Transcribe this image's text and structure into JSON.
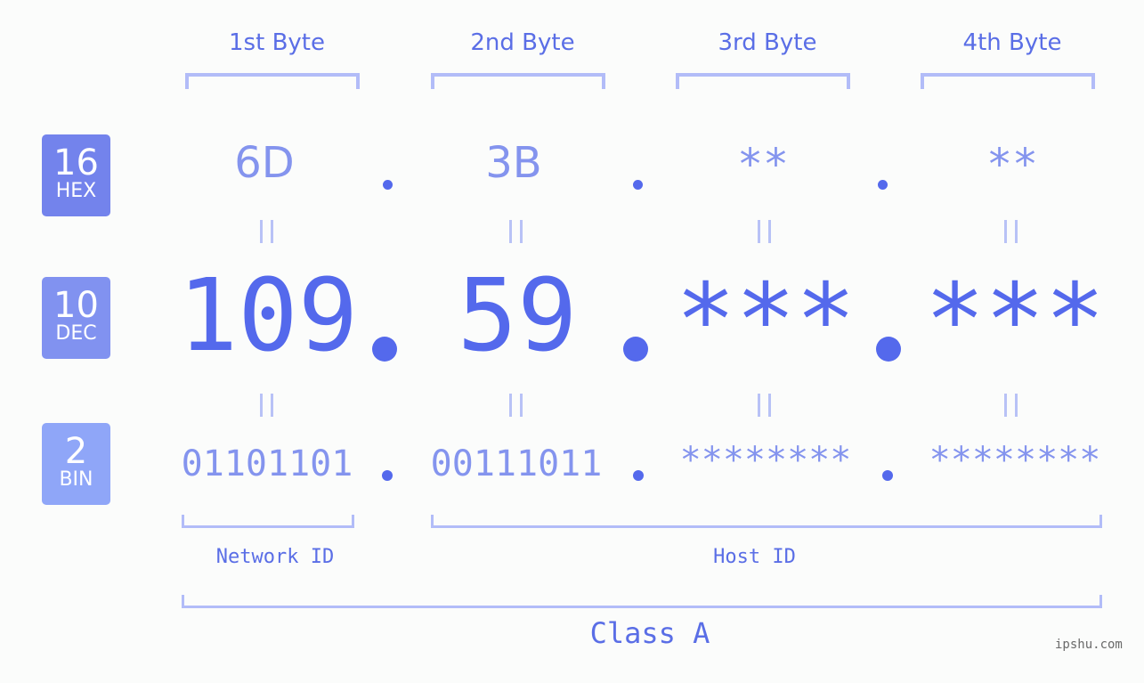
{
  "bytes": [
    {
      "title": "1st Byte",
      "hex": "6D",
      "dec": "109",
      "bin": "01101101"
    },
    {
      "title": "2nd Byte",
      "hex": "3B",
      "dec": "59",
      "bin": "00111011"
    },
    {
      "title": "3rd Byte",
      "hex": "**",
      "dec": "***",
      "bin": "********"
    },
    {
      "title": "4th Byte",
      "hex": "**",
      "dec": "***",
      "bin": "********"
    }
  ],
  "badges": {
    "hex": {
      "number": "16",
      "label": "HEX",
      "color": "#7383ec"
    },
    "dec": {
      "number": "10",
      "label": "DEC",
      "color": "#8192f0"
    },
    "bin": {
      "number": "2",
      "label": "BIN",
      "color": "#8fa6f8"
    }
  },
  "labels": {
    "network_id": "Network ID",
    "host_id": "Host ID",
    "class": "Class A"
  },
  "separator": ".",
  "watermark": "ipshu.com"
}
